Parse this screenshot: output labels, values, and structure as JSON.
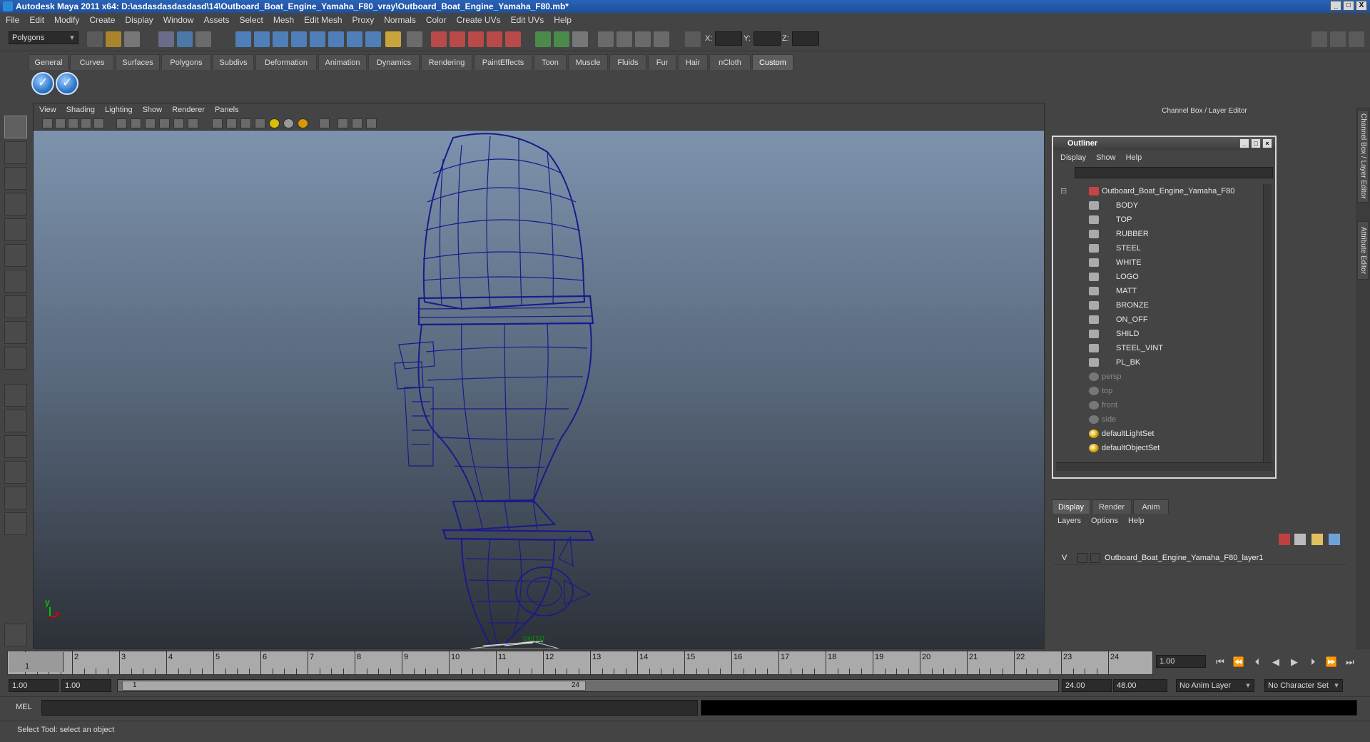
{
  "window": {
    "title": "Autodesk Maya 2011 x64: D:\\asdasdasdasdasd\\14\\Outboard_Boat_Engine_Yamaha_F80_vray\\Outboard_Boat_Engine_Yamaha_F80.mb*",
    "min": "_",
    "max": "□",
    "close": "X"
  },
  "menubar": [
    "File",
    "Edit",
    "Modify",
    "Create",
    "Display",
    "Window",
    "Assets",
    "Select",
    "Mesh",
    "Edit Mesh",
    "Proxy",
    "Normals",
    "Color",
    "Create UVs",
    "Edit UVs",
    "Help"
  ],
  "statusline": {
    "mode": "Polygons",
    "x_label": "X:",
    "y_label": "Y:",
    "z_label": "Z:"
  },
  "shelf": {
    "tabs": [
      "General",
      "Curves",
      "Surfaces",
      "Polygons",
      "Subdivs",
      "Deformation",
      "Animation",
      "Dynamics",
      "Rendering",
      "PaintEffects",
      "Toon",
      "Muscle",
      "Fluids",
      "Fur",
      "Hair",
      "nCloth",
      "Custom"
    ],
    "active_tab": "Custom",
    "buttons": [
      "check-icon",
      "check-icon"
    ]
  },
  "viewport": {
    "menu": [
      "View",
      "Shading",
      "Lighting",
      "Show",
      "Renderer",
      "Panels"
    ],
    "camera_label": "persp",
    "axis_y": "y",
    "axis_x": "x"
  },
  "right_panel": {
    "header": "Channel Box / Layer Editor",
    "side_tabs": [
      "Channel Box / Layer Editor",
      "Attribute Editor"
    ]
  },
  "outliner": {
    "title": "Outliner",
    "menu": [
      "Display",
      "Show",
      "Help"
    ],
    "root": "Outboard_Boat_Engine_Yamaha_F80",
    "children": [
      "BODY",
      "TOP",
      "RUBBER",
      "STEEL",
      "WHITE",
      "LOGO",
      "MATT",
      "BRONZE",
      "ON_OFF",
      "SHILD",
      "STEEL_VINT",
      "PL_BK"
    ],
    "cameras": [
      "persp",
      "top",
      "front",
      "side"
    ],
    "sets": [
      "defaultLightSet",
      "defaultObjectSet"
    ]
  },
  "layer_editor": {
    "tabs": [
      "Display",
      "Render",
      "Anim"
    ],
    "active_tab": "Display",
    "menu": [
      "Layers",
      "Options",
      "Help"
    ],
    "layers": [
      {
        "visible": "V",
        "name": "Outboard_Boat_Engine_Yamaha_F80_layer1"
      }
    ]
  },
  "timeline": {
    "ticks": [
      "1",
      "2",
      "3",
      "4",
      "5",
      "6",
      "7",
      "8",
      "9",
      "10",
      "11",
      "12",
      "13",
      "14",
      "15",
      "16",
      "17",
      "18",
      "19",
      "20",
      "21",
      "22",
      "23",
      "24"
    ],
    "current_frame_display": "1",
    "current_frame_field": "1.00"
  },
  "range": {
    "start": "1.00",
    "anim_start": "1.00",
    "handle_start": "1",
    "handle_end": "24",
    "anim_end": "24.00",
    "end": "48.00",
    "anim_layer": "No Anim Layer",
    "character_set": "No Character Set"
  },
  "command": {
    "label": "MEL"
  },
  "help_line": "Select Tool: select an object",
  "colors": {
    "wireframe": "#1a1a8a",
    "title_bar": "#2a63b8",
    "timeline": "#aaaaaa"
  }
}
